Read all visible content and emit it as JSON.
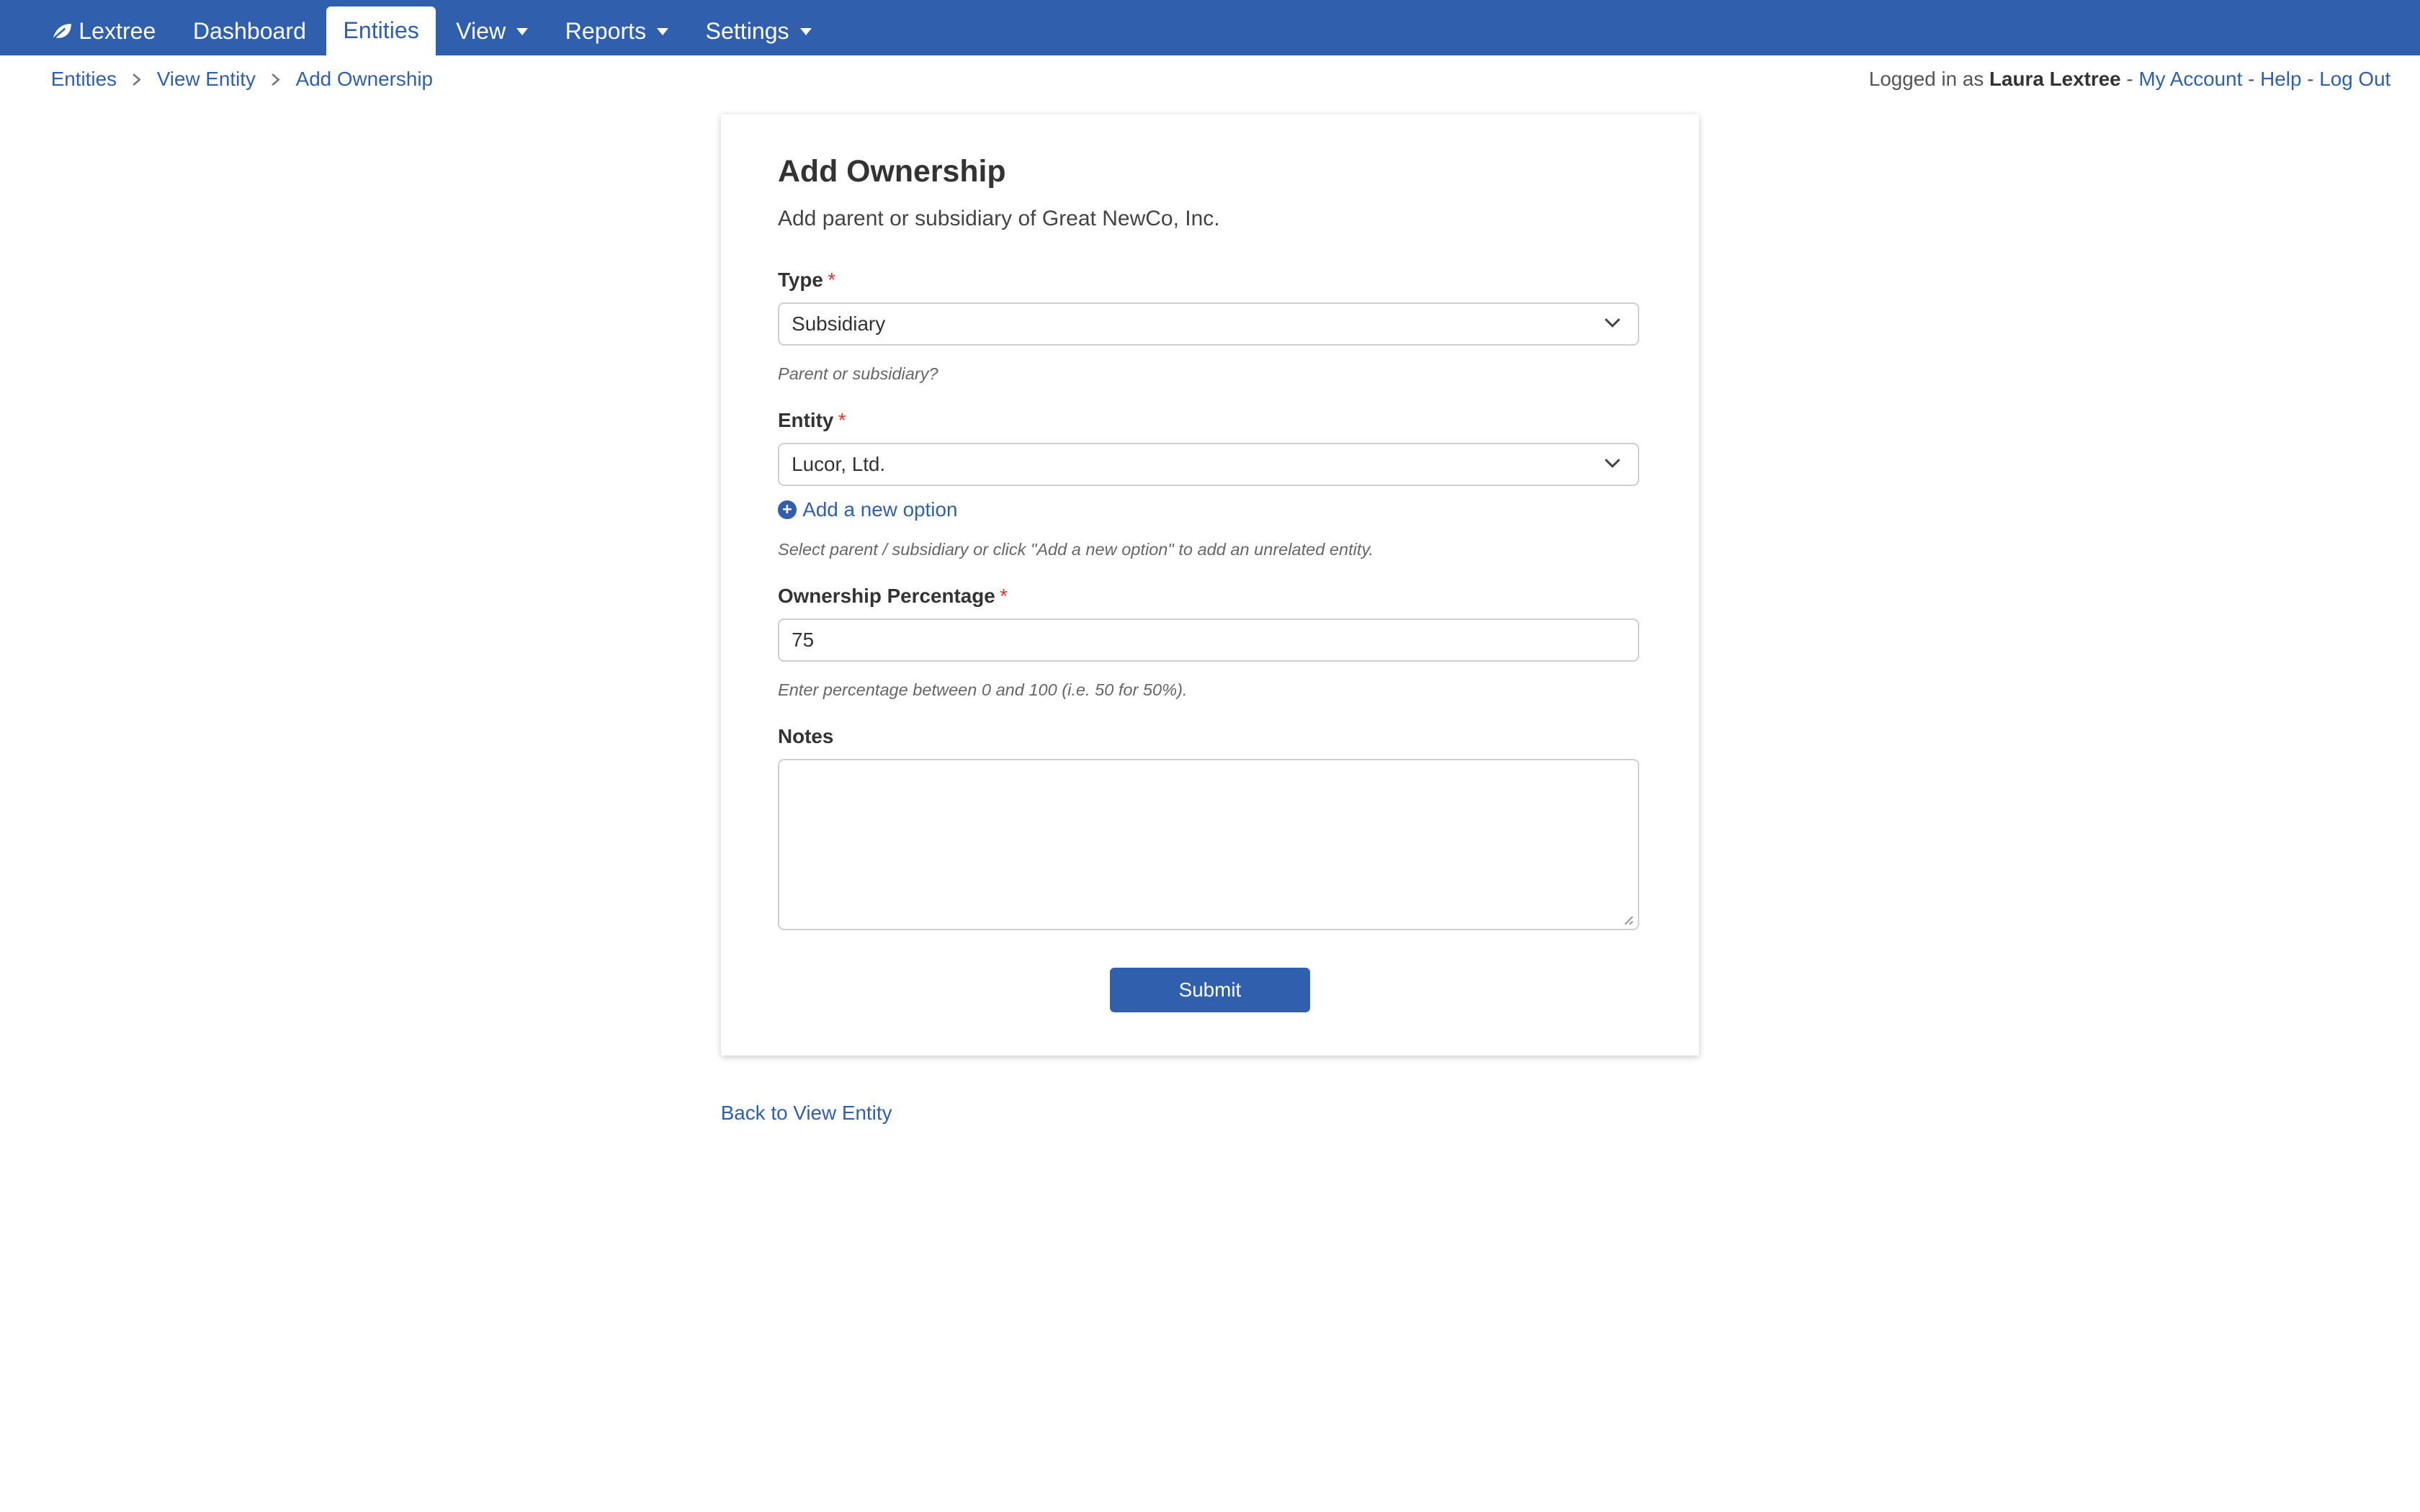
{
  "nav": {
    "brand": "Lextree",
    "items": [
      {
        "label": "Dashboard"
      },
      {
        "label": "Entities"
      },
      {
        "label": "View"
      },
      {
        "label": "Reports"
      },
      {
        "label": "Settings"
      }
    ],
    "active": "Entities"
  },
  "breadcrumb": [
    "Entities",
    "View Entity",
    "Add Ownership"
  ],
  "account": {
    "prefix": "Logged in as",
    "user": "Laura Lextree",
    "separator": "-",
    "links": [
      "My Account",
      "Help",
      "Log Out"
    ]
  },
  "form": {
    "title": "Add Ownership",
    "subtitle": "Add parent or subsidiary of Great NewCo, Inc.",
    "type": {
      "label": "Type",
      "required_mark": "*",
      "value": "Subsidiary",
      "help": "Parent or subsidiary?"
    },
    "entity": {
      "label": "Entity",
      "required_mark": "*",
      "value": "Lucor, Ltd.",
      "add_option": "Add a new option",
      "help": "Select parent / subsidiary or click \"Add a new option\" to add an unrelated entity."
    },
    "percentage": {
      "label": "Ownership Percentage",
      "required_mark": "*",
      "value": "75",
      "help": "Enter percentage between 0 and 100 (i.e. 50 for 50%)."
    },
    "notes": {
      "label": "Notes",
      "value": ""
    },
    "submit": "Submit"
  },
  "back_link": "Back to View Entity",
  "colors": {
    "nav_bg": "#2f5fad",
    "accent": "#2f5fad",
    "required": "#d9362b"
  }
}
